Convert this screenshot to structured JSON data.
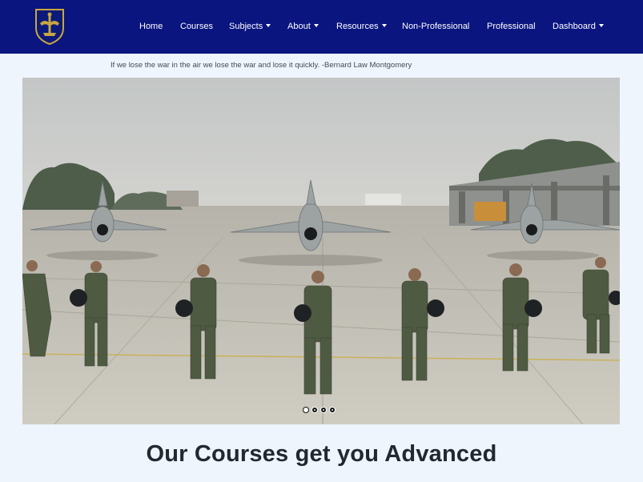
{
  "navbar": {
    "logo_icon": "air-force-crest-icon",
    "brand_color": "#0a1580",
    "items": [
      {
        "label": "Home",
        "dropdown": false
      },
      {
        "label": "Courses",
        "dropdown": false
      },
      {
        "label": "Subjects",
        "dropdown": true
      },
      {
        "label": "About",
        "dropdown": true
      },
      {
        "label": "Resources",
        "dropdown": true
      },
      {
        "label": "Non-Professional",
        "dropdown": false
      },
      {
        "label": "Professional",
        "dropdown": false
      },
      {
        "label": "Dashboard",
        "dropdown": true
      }
    ]
  },
  "quote": {
    "text": "If we lose the war in the air we lose the war and lose it quickly. -Bernard Law Montgomery"
  },
  "carousel": {
    "slide_description_icon": "pilots-and-fighter-jets-photo",
    "slides_count": 4,
    "active_index": 0
  },
  "section": {
    "heading": "Our Courses get you Advanced"
  }
}
